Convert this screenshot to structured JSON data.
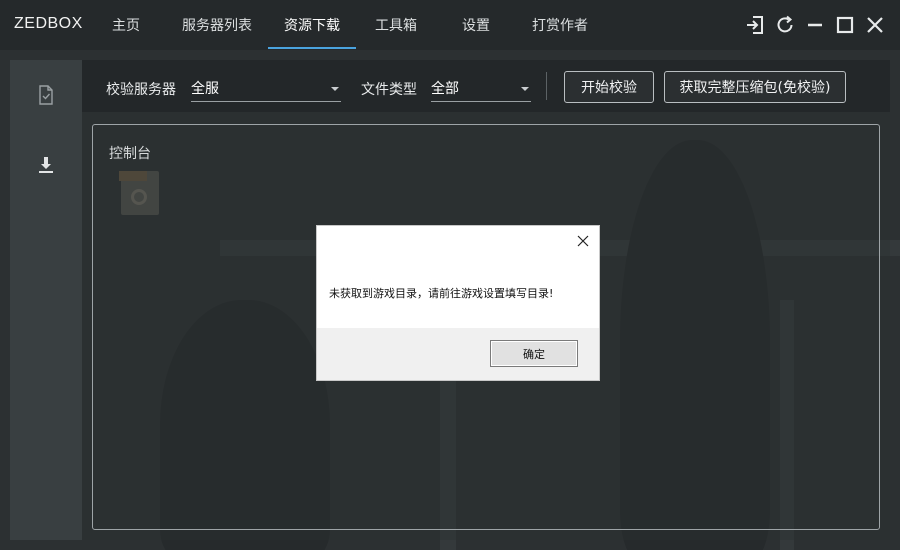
{
  "app": {
    "brand": "ZEDBOX",
    "nav_tabs": [
      {
        "label": "主页"
      },
      {
        "label": "服务器列表"
      },
      {
        "label": "资源下载",
        "active": true
      },
      {
        "label": "工具箱"
      },
      {
        "label": "设置"
      },
      {
        "label": "打赏作者"
      }
    ],
    "window_controls": [
      "exit-icon",
      "refresh-icon",
      "minimize-icon",
      "maximize-icon",
      "close-icon"
    ],
    "accent_color": "#4aa3df"
  },
  "sidebar": {
    "items": [
      {
        "icon": "file-check-icon"
      },
      {
        "icon": "download-icon"
      }
    ]
  },
  "toolbar": {
    "server_label": "校验服务器",
    "server_value": "全服",
    "filetype_label": "文件类型",
    "filetype_value": "全部",
    "start_button": "开始校验",
    "full_package_button": "获取完整压缩包(免校验)"
  },
  "console": {
    "title": "控制台"
  },
  "dialog": {
    "message": "未获取到游戏目录，请前往游戏设置填写目录!",
    "ok_label": "确定"
  }
}
